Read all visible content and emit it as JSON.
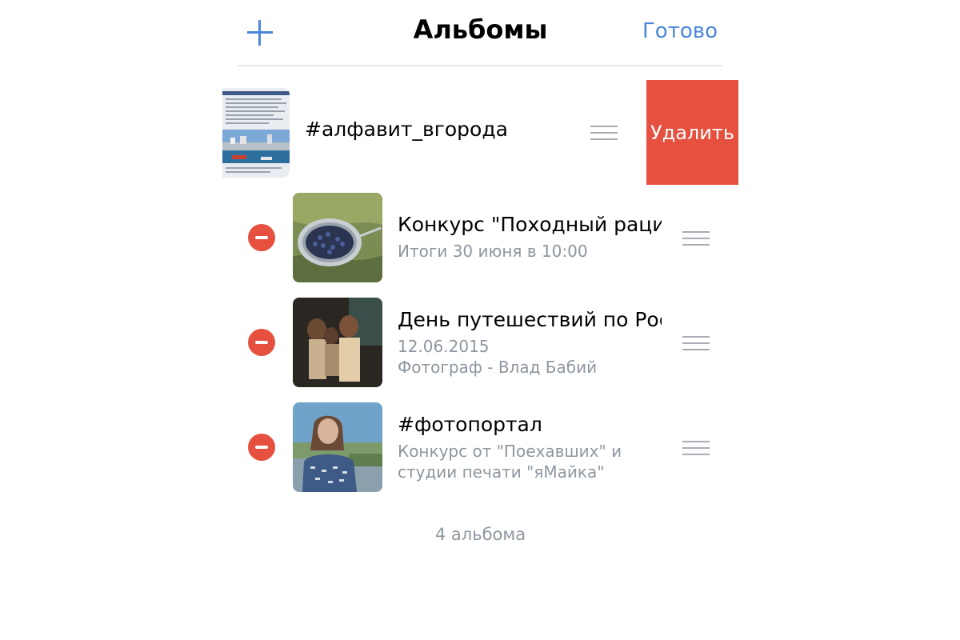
{
  "navbar": {
    "title": "Альбомы",
    "done_label": "Готово",
    "add_icon": "plus-icon",
    "accent_color": "#4a86d9"
  },
  "swiped_album": {
    "title": "#алфавит_вгорода",
    "delete_label": "Удалить",
    "delete_color": "#e5503f"
  },
  "albums": [
    {
      "title": "Конкурс \"Походный раци...",
      "subtitle": "Итоги 30 июня в 10:00"
    },
    {
      "title": "День путешествий по Рос...",
      "subtitle": "12.06.2015",
      "subtitle2": "Фотограф - Влад Бабий"
    },
    {
      "title": "#фотопортал",
      "subtitle": "Конкурс от \"Поехавших\" и",
      "subtitle2": "студии печати \"яМайка\""
    }
  ],
  "footer": {
    "count_label": "4 альбома"
  }
}
